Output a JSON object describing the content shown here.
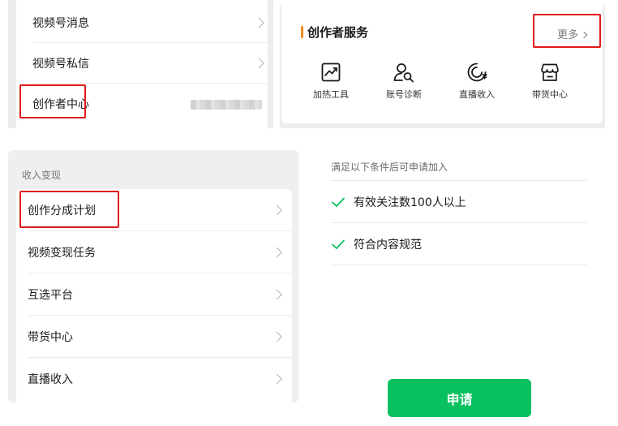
{
  "menu_top": {
    "items": [
      {
        "label": "视频号消息"
      },
      {
        "label": "视频号私信"
      },
      {
        "label": "创作者中心"
      }
    ]
  },
  "creator_services": {
    "title": "创作者服务",
    "more_label": "更多",
    "items": [
      {
        "label": "加热工具",
        "icon": "trend-chart-icon"
      },
      {
        "label": "账号诊断",
        "icon": "user-search-icon"
      },
      {
        "label": "直播收入",
        "icon": "live-income-icon"
      },
      {
        "label": "带货中心",
        "icon": "storefront-icon"
      }
    ],
    "accent_color": "#f08a1e"
  },
  "income": {
    "section_title": "收入变现",
    "items": [
      {
        "label": "创作分成计划"
      },
      {
        "label": "视频变现任务"
      },
      {
        "label": "互选平台"
      },
      {
        "label": "带货中心"
      },
      {
        "label": "直播收入"
      }
    ]
  },
  "conditions": {
    "heading": "满足以下条件后可申请加入",
    "items": [
      {
        "text": "有效关注数100人以上"
      },
      {
        "text": "符合内容规范"
      }
    ],
    "check_color": "#07c160",
    "apply_label": "申请",
    "apply_color": "#07c160"
  },
  "highlight_color": "#e11b1b"
}
